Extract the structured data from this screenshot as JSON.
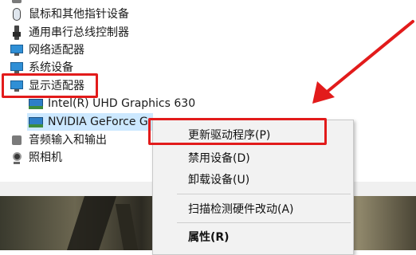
{
  "device_tree": {
    "items": [
      {
        "label": "鼠标和其他指针设备",
        "icon": "mouse-icon"
      },
      {
        "label": "通用串行总线控制器",
        "icon": "usb-icon"
      },
      {
        "label": "网络适配器",
        "icon": "network-adapter-icon"
      },
      {
        "label": "系统设备",
        "icon": "system-device-icon"
      },
      {
        "label": "显示适配器",
        "icon": "display-adapter-icon"
      },
      {
        "label": "Intel(R) UHD Graphics 630",
        "icon": "gpu-icon"
      },
      {
        "label": "NVIDIA GeForce G",
        "icon": "gpu-icon"
      },
      {
        "label": "音频输入和输出",
        "icon": "speaker-icon"
      },
      {
        "label": "照相机",
        "icon": "camera-icon"
      }
    ]
  },
  "context_menu": {
    "items": [
      {
        "label": "更新驱动程序(P)"
      },
      {
        "label": "禁用设备(D)"
      },
      {
        "label": "卸载设备(U)"
      },
      {
        "label": "扫描检测硬件改动(A)"
      },
      {
        "label": "属性(R)"
      }
    ]
  },
  "colors": {
    "highlight": "#e21b1b",
    "selection": "#cce8ff"
  }
}
